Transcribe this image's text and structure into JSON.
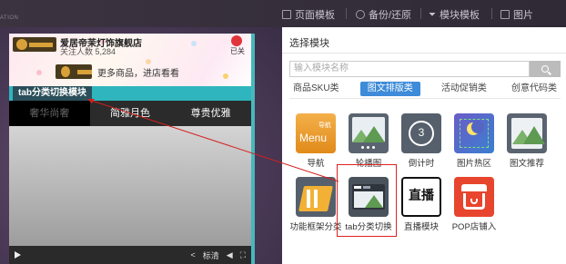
{
  "toolbar": {
    "faded_label": "ATION",
    "items": [
      {
        "label": "页面模板"
      },
      {
        "label": "备份/还原"
      },
      {
        "label": "模块模板"
      },
      {
        "label": "图片"
      }
    ]
  },
  "preview": {
    "store_name": "爱居帝茉灯饰旗舰店",
    "followers": "关注人数 5,284",
    "fav_label": "已关",
    "promo_text": "更多商品，进店看看",
    "selected_module_tag": "tab分类切换模块",
    "tabs": [
      {
        "label": "奢华尚奢",
        "active": true
      },
      {
        "label": "简雅月色",
        "active": false
      },
      {
        "label": "尊贵优雅",
        "active": false
      }
    ],
    "controls": {
      "speed": "标清"
    }
  },
  "panel": {
    "title": "选择模块",
    "search_placeholder": "输入模块名称",
    "categories": [
      {
        "label": "商品SKU类",
        "active": false
      },
      {
        "label": "图文排版类",
        "active": true
      },
      {
        "label": "活动促销类",
        "active": false
      },
      {
        "label": "创意代码类",
        "active": false
      }
    ],
    "modules": [
      {
        "label": "导航",
        "icon": "menu-nav-icon",
        "icon_text": "导航",
        "icon_text2": "Menu"
      },
      {
        "label": "轮播图",
        "icon": "carousel-icon"
      },
      {
        "label": "倒计时",
        "icon": "countdown-icon",
        "icon_text": "3"
      },
      {
        "label": "图片热区",
        "icon": "image-hotspot-icon"
      },
      {
        "label": "图文推荐",
        "icon": "image-text-recommend-icon"
      },
      {
        "label": "功能框架分类",
        "icon": "frame-category-icon"
      },
      {
        "label": "tab分类切换",
        "icon": "tab-switch-icon"
      },
      {
        "label": "直播模块",
        "icon": "live-broadcast-icon",
        "icon_text": "直播"
      },
      {
        "label": "POP店铺入",
        "icon": "pop-store-icon"
      }
    ]
  },
  "colors": {
    "accent": "#3d8bd9",
    "selection": "#2fb5bd",
    "highlight": "#e02020"
  }
}
